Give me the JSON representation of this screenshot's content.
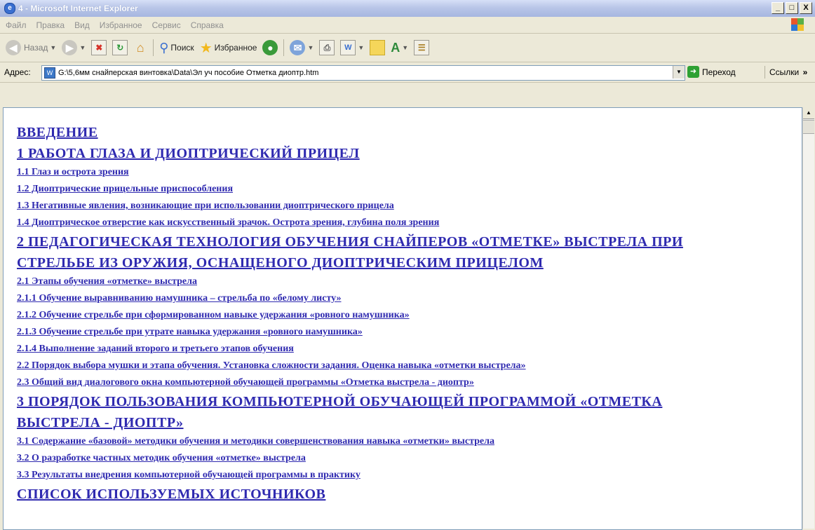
{
  "window": {
    "title": "4 - Microsoft Internet Explorer",
    "buttons": [
      "_",
      "□",
      "X"
    ]
  },
  "menu": [
    "Файл",
    "Правка",
    "Вид",
    "Избранное",
    "Сервис",
    "Справка"
  ],
  "toolbar": {
    "back_label": "Назад",
    "search_label": "Поиск",
    "favorites_label": "Избранное"
  },
  "address": {
    "label": "Адрес:",
    "value": "G:\\5,6мм снайперская винтовка\\Data\\Эл уч пособие Отметка диоптр.htm",
    "go_label": "Переход",
    "links_label": "Ссылки"
  },
  "toc": [
    {
      "text": "ВВЕДЕНИЕ",
      "level": 1
    },
    {
      "text": "1 РАБОТА ГЛАЗА И ДИОПТРИЧЕСКИЙ ПРИЦЕЛ",
      "level": 1
    },
    {
      "text": "1.1 Глаз и острота зрения",
      "level": 2
    },
    {
      "text": "1.2 Диоптрические прицельные приспособления",
      "level": 2
    },
    {
      "text": "1.3 Негативные явления, возникающие при использовании диоптрического прицела",
      "level": 2
    },
    {
      "text": "1.4 Диоптрическое отверстие как искусственный зрачок. Острота зрения, глубина поля зрения",
      "level": 2
    },
    {
      "text": "2 ПЕДАГОГИЧЕСКАЯ ТЕХНОЛОГИЯ ОБУЧЕНИЯ СНАЙПЕРОВ «ОТМЕТКЕ» ВЫСТРЕЛА ПРИ",
      "level": 1
    },
    {
      "text": "СТРЕЛЬБЕ ИЗ ОРУЖИЯ, ОСНАЩЕНОГО ДИОПТРИЧЕСКИМ ПРИЦЕЛОМ",
      "level": 1
    },
    {
      "text": "2.1 Этапы обучения «отметке» выстрела",
      "level": 2
    },
    {
      "text": "2.1.1 Обучение выравниванию намушника – стрельба по «белому листу»",
      "level": 2
    },
    {
      "text": "2.1.2 Обучение стрельбе при сформированном навыке удержания «ровного намушника»",
      "level": 2
    },
    {
      "text": "2.1.3 Обучение стрельбе при утрате навыка удержания «ровного намушника»",
      "level": 2
    },
    {
      "text": "2.1.4 Выполнение заданий второго и третьего этапов обучения",
      "level": 2
    },
    {
      "text": "2.2 Порядок выбора мушки и этапа обучения. Установка сложности задания. Оценка навыка «отметки выстрела»",
      "level": 2
    },
    {
      "text": "2.3 Общий вид диалогового окна компьютерной обучающей программы «Отметка выстрела - диоптр»",
      "level": 2
    },
    {
      "text": "3 ПОРЯДОК ПОЛЬЗОВАНИЯ КОМПЬЮТЕРНОЙ ОБУЧАЮЩЕЙ ПРОГРАММОЙ «ОТМЕТКА",
      "level": 1
    },
    {
      "text": "ВЫСТРЕЛА - ДИОПТР»",
      "level": 1
    },
    {
      "text": "3.1 Содержание «базовой» методики обучения и методики совершенствования навыка «отметки» выстрела",
      "level": 2
    },
    {
      "text": "3.2 О разработке частных методик обучения «отметке» выстрела",
      "level": 2
    },
    {
      "text": "3.3 Результаты внедрения компьютерной обучающей программы в практику",
      "level": 2
    },
    {
      "text": "СПИСОК ИСПОЛЬЗУЕМЫХ ИСТОЧНИКОВ",
      "level": 1
    }
  ],
  "colors": {
    "link": "#2f2ab0",
    "chrome": "#ece9d8",
    "title_gradient": "#b9c6e8"
  }
}
